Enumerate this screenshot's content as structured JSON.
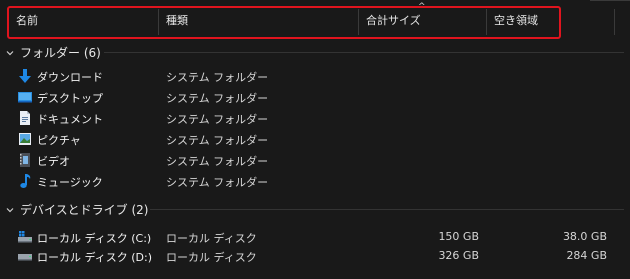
{
  "columns": {
    "name": "名前",
    "type": "種類",
    "total_size": "合計サイズ",
    "free_space": "空き領域",
    "sort_indicator": "^"
  },
  "groups": {
    "folders": {
      "label": "フォルダー (6)",
      "items": [
        {
          "name": "ダウンロード",
          "type": "システム フォルダー",
          "icon": "download-arrow-icon"
        },
        {
          "name": "デスクトップ",
          "type": "システム フォルダー",
          "icon": "desktop-icon"
        },
        {
          "name": "ドキュメント",
          "type": "システム フォルダー",
          "icon": "document-icon"
        },
        {
          "name": "ピクチャ",
          "type": "システム フォルダー",
          "icon": "picture-icon"
        },
        {
          "name": "ビデオ",
          "type": "システム フォルダー",
          "icon": "video-icon"
        },
        {
          "name": "ミュージック",
          "type": "システム フォルダー",
          "icon": "music-note-icon"
        }
      ]
    },
    "drives": {
      "label": "デバイスとドライブ (2)",
      "items": [
        {
          "name": "ローカル ディスク (C:)",
          "type": "ローカル ディスク",
          "total": "150 GB",
          "free": "38.0 GB",
          "icon": "system-drive-icon"
        },
        {
          "name": "ローカル ディスク (D:)",
          "type": "ローカル ディスク",
          "total": "326 GB",
          "free": "284 GB",
          "icon": "drive-icon"
        }
      ]
    }
  },
  "colors": {
    "background": "#191919",
    "highlight_border": "#e0141e",
    "accent_blue": "#1e88e5"
  }
}
